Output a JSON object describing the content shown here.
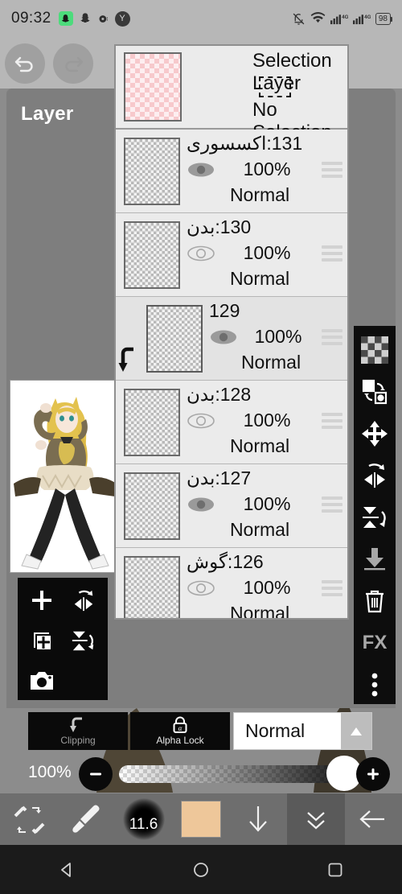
{
  "statusbar": {
    "time": "09:32",
    "icons": [
      "snapchat-icon",
      "ghost-icon",
      "record-icon",
      "y-app-icon"
    ],
    "y_label": "Y",
    "right_icons": [
      "silent-icon",
      "wifi-icon",
      "signal-4g-icon",
      "signal-4g-icon-2"
    ],
    "battery": "98",
    "network1": "4G",
    "network2": "4G"
  },
  "topbar": {
    "undo": "undo-icon",
    "redo": "redo-icon"
  },
  "panel": {
    "title": "Layer"
  },
  "selection_layer": {
    "title": "Selection Layer",
    "status": "No Selection"
  },
  "layers": [
    {
      "name": "131:اکسسوری",
      "opacity": "100%",
      "mode": "Normal",
      "visible": true,
      "selected": false,
      "clipped": false
    },
    {
      "name": "130:بدن",
      "opacity": "100%",
      "mode": "Normal",
      "visible": false,
      "selected": false,
      "clipped": false
    },
    {
      "name": "129",
      "opacity": "100%",
      "mode": "Normal",
      "visible": true,
      "selected": true,
      "clipped": true
    },
    {
      "name": "128:بدن",
      "opacity": "100%",
      "mode": "Normal",
      "visible": false,
      "selected": false,
      "clipped": false
    },
    {
      "name": "127:بدن",
      "opacity": "100%",
      "mode": "Normal",
      "visible": true,
      "selected": false,
      "clipped": false
    },
    {
      "name": "126:گوش",
      "opacity": "100%",
      "mode": "Normal",
      "visible": false,
      "selected": false,
      "clipped": false
    }
  ],
  "right_toolbar": [
    "transparency-checker-icon",
    "transform-swap-icon",
    "move-icon",
    "flip-horizontal-icon",
    "flip-vertical-icon",
    "merge-down-icon",
    "delete-layer-icon",
    "fx-icon",
    "more-options-icon"
  ],
  "right_toolbar_fx_label": "FX",
  "left_toolbar": [
    "add-layer-icon",
    "flip-horizontal-icon",
    "duplicate-layer-icon",
    "flip-vertical-icon",
    "camera-import-icon"
  ],
  "blend_bar": {
    "clipping_label": "Clipping",
    "clipping_icon": "clipping-arrow-icon",
    "alpha_lock_label": "Alpha Lock",
    "alpha_lock_icon": "alpha-lock-icon",
    "blend_mode": "Normal",
    "blend_arrow_icon": "chevron-up-icon"
  },
  "opacity_bar": {
    "value": "100%",
    "minus": "−",
    "plus": "+"
  },
  "toolbar": {
    "brush_eraser_swap": "brush-eraser-swap-icon",
    "brush": "brush-icon",
    "brush_size": "11.6",
    "color": "#eec79a",
    "download_icon": "arrow-down-icon",
    "collapse_icon": "double-chevron-down-icon",
    "back_icon": "arrow-left-icon"
  },
  "navbar": {
    "back": "nav-back-icon",
    "home": "nav-home-icon",
    "recents": "nav-recents-icon"
  },
  "colors": {
    "panel_bg": "#7e7e7e",
    "list_bg": "#ebebeb",
    "canvas_bg": "#8c8c8c",
    "toolbar_dark": "#0a0a0a",
    "swatch": "#eec79a"
  }
}
